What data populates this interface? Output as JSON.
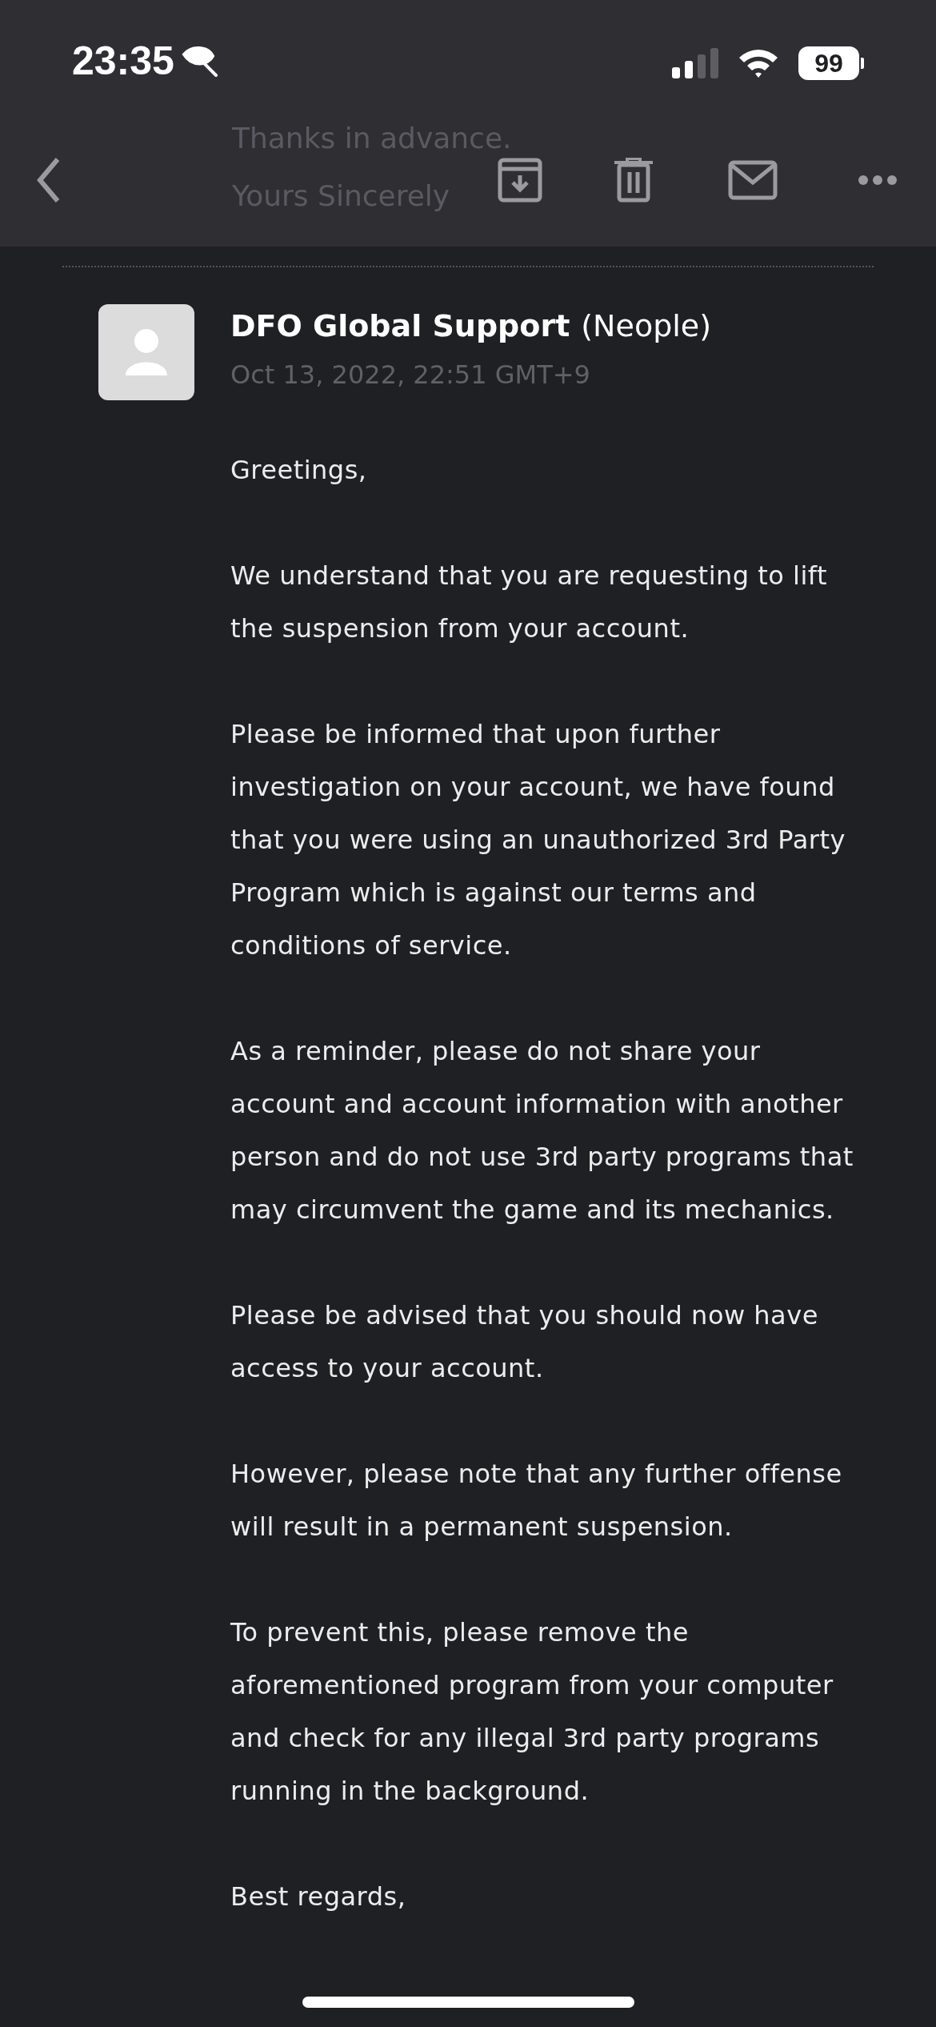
{
  "status_bar": {
    "time": "23:35",
    "battery": "99"
  },
  "scrolled_text": [
    "Thanks in advance.",
    "Yours Sincerely"
  ],
  "message": {
    "sender": "DFO Global Support",
    "organization": "(Neople)",
    "date": "Oct 13, 2022, 22:51 GMT+9",
    "paragraphs": [
      "Greetings,",
      "We understand that you are requesting to lift the suspension from your account.",
      "Please be informed that upon further investigation on your account, we have found that you were using an unauthorized 3rd Party Program which is against our terms and conditions of service.",
      "As a reminder, please do not share your account and account information with another person and do not use 3rd party programs that may circumvent the game and its mechanics.",
      "Please be advised that you should now have access to your account.",
      "However, please note that any further offense will result in a permanent suspension.",
      "To prevent this, please remove the aforementioned program from your computer and check for any illegal 3rd party programs running in the background.",
      "Best regards,"
    ]
  }
}
